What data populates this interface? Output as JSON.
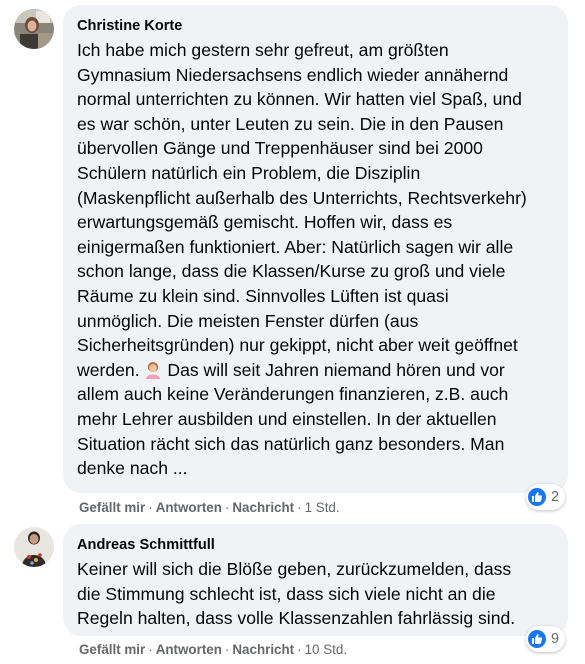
{
  "comments": [
    {
      "author": "Christine Korte",
      "lines": [
        "Ich habe mich gestern sehr gefreut, am größten",
        "Gymnasium Niedersachsens endlich wieder annähernd",
        "normal unterrichten zu können. Wir hatten viel Spaß, und",
        "es war schön, unter Leuten zu sein. Die in den Pausen",
        "übervollen Gänge und Treppenhäuser sind bei 2000",
        "Schülern natürlich ein Problem, die Disziplin",
        "(Maskenpflicht außerhalb des Unterrichts, Rechtsverkehr)",
        "erwartungsgemäß gemischt. Hoffen wir, dass es",
        "einigermaßen funktioniert. Aber: Natürlich sagen wir alle",
        "schon lange, dass die Klassen/Kurse zu groß und viele",
        "Räume zu klein sind. Sinnvolles Lüften ist quasi",
        "unmöglich. Die meisten Fenster dürfen (aus",
        "Sicherheitsgründen) nur gekippt, nicht aber weit geöffnet",
        "werden.",
        "Das will seit Jahren niemand hören und vor",
        "allem auch keine Veränderungen finanzieren, z.B. auch",
        "mehr Lehrer ausbilden und einstellen. In der aktuellen",
        "Situation rächt sich das natürlich ganz besonders. Man",
        "denke nach ..."
      ],
      "actions": {
        "like": "Gefällt mir",
        "reply": "Antworten",
        "message": "Nachricht",
        "time": "1 Std."
      },
      "reaction_count": "2",
      "emoji": "person-facepalming-emoji"
    },
    {
      "author": "Andreas Schmittfull",
      "lines": [
        "Keiner will sich die Blöße geben, zurückzumelden, dass",
        "die Stimmung schlecht ist, dass sich viele nicht an die",
        "Regeln halten, dass volle Klassenzahlen fahrlässig sind."
      ],
      "actions": {
        "like": "Gefällt mir",
        "reply": "Antworten",
        "message": "Nachricht",
        "time": "10 Std."
      },
      "reaction_count": "9"
    }
  ],
  "separator": "·",
  "colors": {
    "bubble": "#f0f2f5",
    "text": "#050505",
    "meta": "#65676b",
    "like_blue": "#1877f2"
  },
  "icons": {
    "reaction": "thumbs-up-icon"
  }
}
